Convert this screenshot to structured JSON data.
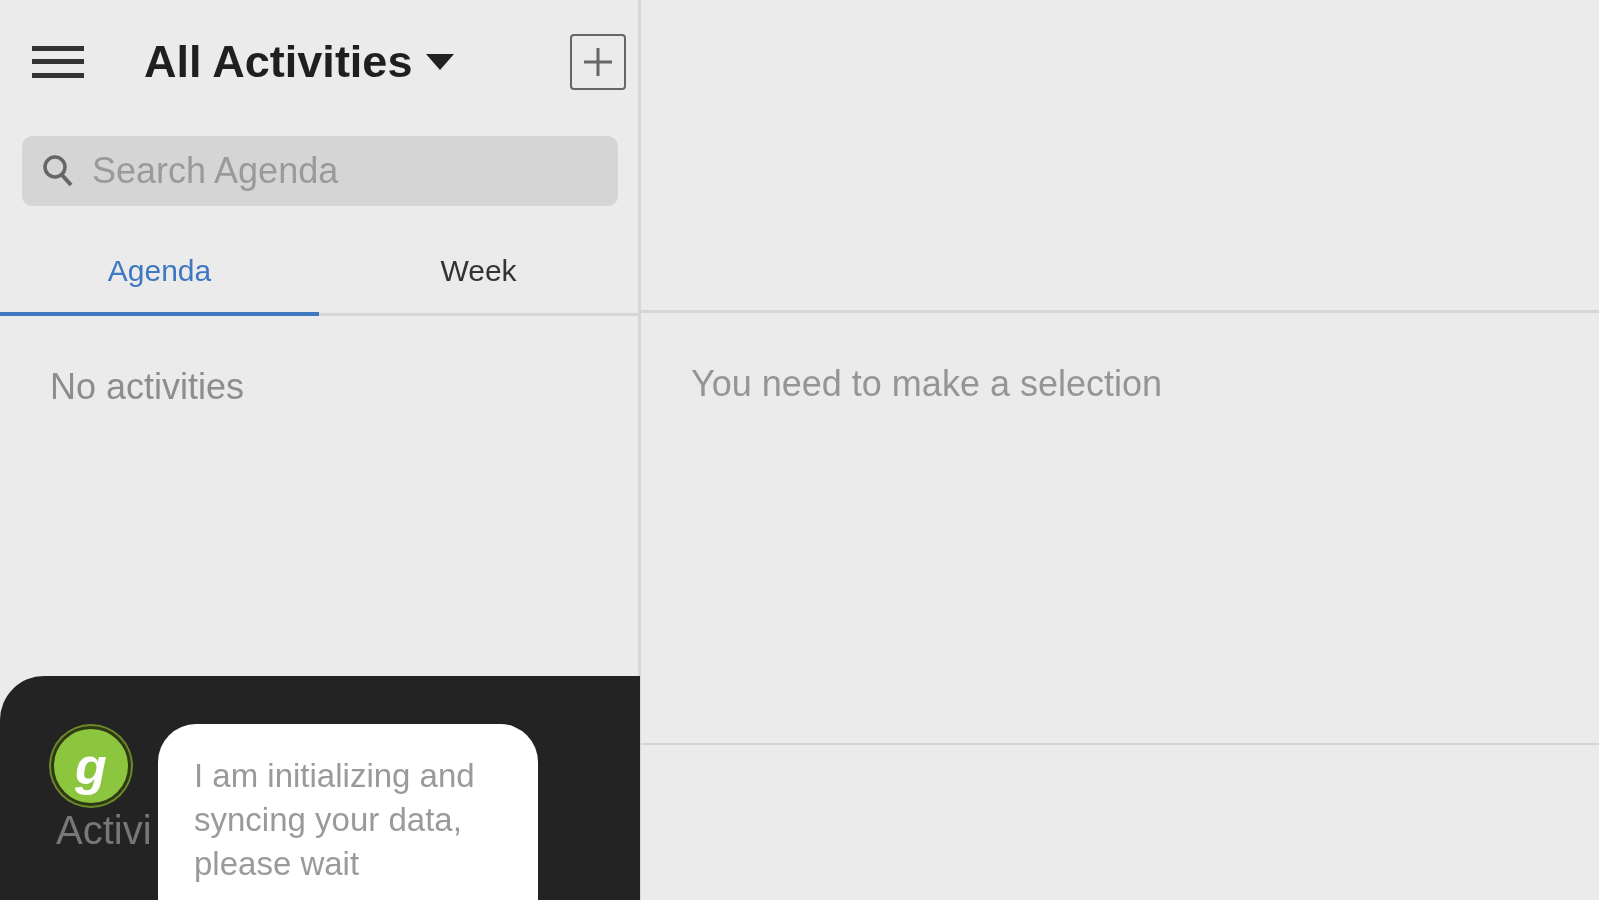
{
  "header": {
    "title": "All Activities"
  },
  "search": {
    "placeholder": "Search Agenda"
  },
  "tabs": [
    {
      "label": "Agenda",
      "selected": true
    },
    {
      "label": "Week",
      "selected": false
    }
  ],
  "list": {
    "empty_text": "No activities"
  },
  "detail": {
    "empty_text": "You need to make a selection"
  },
  "assistant": {
    "avatar_letter": "g",
    "hidden_label": "Activi",
    "message": "I am initializing and syncing your data, please wait"
  }
}
